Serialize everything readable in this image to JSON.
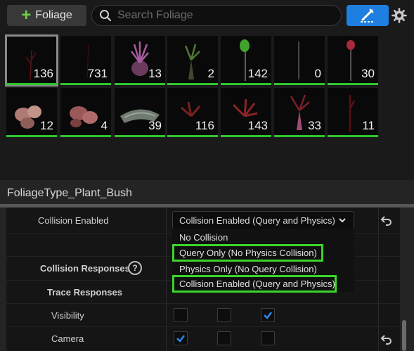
{
  "toolbar": {
    "add_label": "Foliage",
    "search_placeholder": "Search Foliage",
    "search_value": ""
  },
  "tiles": [
    {
      "count": "136",
      "selected": true
    },
    {
      "count": "731"
    },
    {
      "count": "13"
    },
    {
      "count": "2"
    },
    {
      "count": "142"
    },
    {
      "count": "0"
    },
    {
      "count": "30"
    },
    {
      "count": "12"
    },
    {
      "count": "4"
    },
    {
      "count": "39"
    },
    {
      "count": "116"
    },
    {
      "count": "143"
    },
    {
      "count": "33"
    },
    {
      "count": "11"
    }
  ],
  "details": {
    "title": "FoliageType_Plant_Bush",
    "collision_enabled_label": "Collision Enabled",
    "collision_enabled_value": "Collision Enabled (Query and Physics)",
    "collision_responses_label": "Collision Responses",
    "trace_responses_label": "Trace Responses",
    "visibility_label": "Visibility",
    "camera_label": "Camera",
    "visibility_checks": [
      false,
      false,
      true
    ],
    "camera_checks": [
      true,
      false,
      false
    ]
  },
  "dropdown": {
    "options": [
      {
        "label": "No Collision",
        "highlighted": false
      },
      {
        "label": "Query Only (No Physics Collision)",
        "highlighted": true
      },
      {
        "label": "Physics Only (No Query Collision)",
        "highlighted": false
      },
      {
        "label": "Collision Enabled (Query and Physics)",
        "highlighted": true
      }
    ]
  },
  "colors": {
    "accent_blue": "#1f7fe0",
    "highlight_green": "#3ad52a",
    "tile_bar_green": "#2fc42f"
  }
}
